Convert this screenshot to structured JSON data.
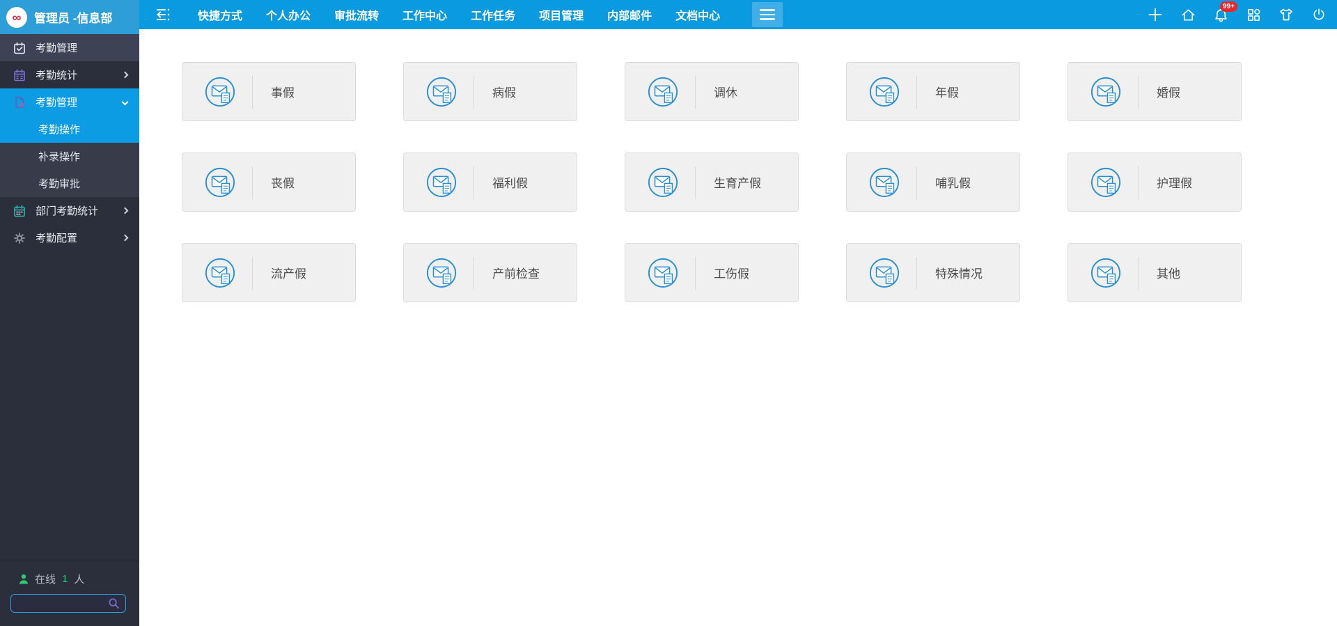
{
  "topbar": {
    "logo_title": "管理员 -信息部",
    "nav_items": [
      "快捷方式",
      "个人办公",
      "审批流转",
      "工作中心",
      "工作任务",
      "项目管理",
      "内部邮件",
      "文档中心"
    ],
    "right_icons": [
      {
        "name": "plus"
      },
      {
        "name": "home"
      },
      {
        "name": "bell",
        "badge": "99+"
      },
      {
        "name": "apps"
      },
      {
        "name": "theme-shirt"
      },
      {
        "name": "power"
      }
    ]
  },
  "sidebar": {
    "items": [
      {
        "label": "考勤管理",
        "icon": "calendar-check-icon",
        "variant": "header"
      },
      {
        "label": "考勤统计",
        "icon": "calendar-icon",
        "chevron": "right"
      },
      {
        "label": "考勤管理",
        "icon": "file-icon",
        "chevron": "down",
        "variant": "expanded",
        "children": [
          {
            "label": "考勤操作",
            "active": true
          },
          {
            "label": "补录操作",
            "active": false
          },
          {
            "label": "考勤审批",
            "active": false
          }
        ]
      },
      {
        "label": "部门考勤统计",
        "icon": "calendar-stats-icon",
        "chevron": "right"
      },
      {
        "label": "考勤配置",
        "icon": "gear-icon",
        "chevron": "right"
      }
    ],
    "online": {
      "icon": "person-icon",
      "prefix": "在线",
      "count": "1",
      "suffix": "人"
    },
    "search": {
      "value": "",
      "icon": "search-icon"
    }
  },
  "content": {
    "card_icon": "mail-document-icon",
    "cards": [
      "事假",
      "病假",
      "调休",
      "年假",
      "婚假",
      "丧假",
      "福利假",
      "生育产假",
      "哺乳假",
      "护理假",
      "流产假",
      "产前检查",
      "工伤假",
      "特殊情况",
      "其他"
    ]
  },
  "colors": {
    "topbar": "#0a9ae0",
    "logo_block": "#2d9ed8",
    "sidebar": "#2b2e3b",
    "active_blue": "#0c9ce4",
    "badge_red": "#e8262d",
    "card_icon_blue": "#2a8fd2",
    "online_green": "#2ecc71"
  }
}
